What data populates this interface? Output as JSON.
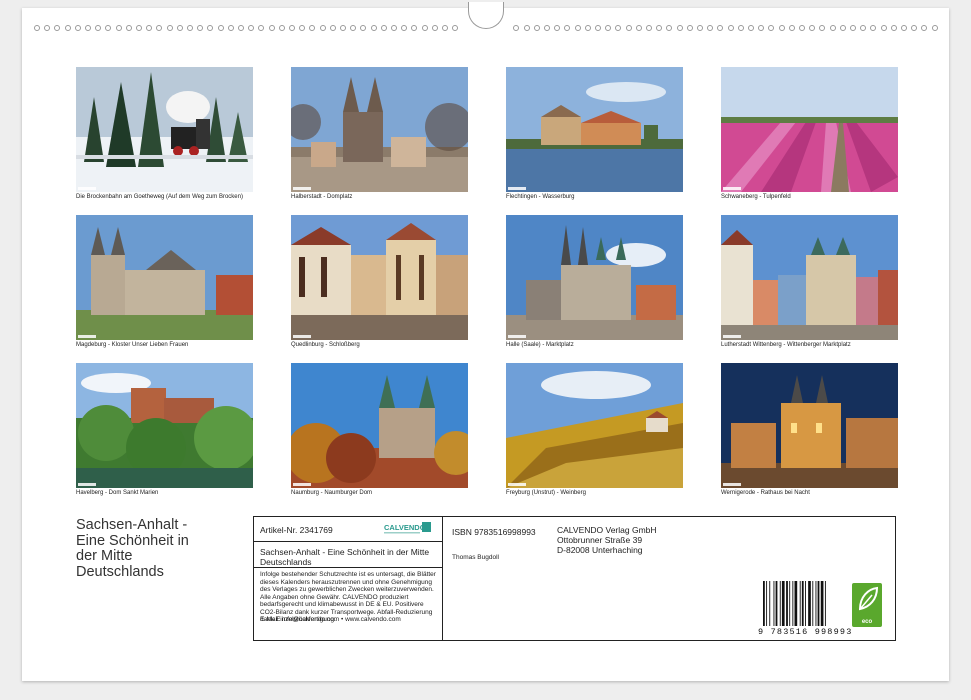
{
  "calendar": {
    "title_lines": [
      "Sachsen-Anhalt -",
      "Eine Schönheit in",
      "der Mitte",
      "Deutschlands"
    ]
  },
  "photos": [
    {
      "caption": "Die Brockenbahn am Goetheweg (Auf dem Weg zum Brocken)",
      "scene": "winter-train"
    },
    {
      "caption": "Halberstadt - Domplatz",
      "scene": "cathedral-twin-spires"
    },
    {
      "caption": "Flechtingen - Wasserburg",
      "scene": "water-castle"
    },
    {
      "caption": "Schwaneberg - Tulpenfeld",
      "scene": "tulip-field"
    },
    {
      "caption": "Magdeburg - Kloster Unser Lieben Frauen",
      "scene": "monastery"
    },
    {
      "caption": "Quedlinburg - Schloßberg",
      "scene": "half-timbered-houses"
    },
    {
      "caption": "Halle (Saale) - Marktplatz",
      "scene": "market-square"
    },
    {
      "caption": "Lutherstadt Wittenberg - Wittenberger Marktplatz",
      "scene": "wittenberg-square"
    },
    {
      "caption": "Havelberg - Dom Sankt Marien",
      "scene": "cathedral-green"
    },
    {
      "caption": "Naumburg - Naumburger Dom",
      "scene": "naumburg-cathedral"
    },
    {
      "caption": "Freyburg (Unstrut) - Weinberg",
      "scene": "vineyard"
    },
    {
      "caption": "Wernigerode - Rathaus bei Nacht",
      "scene": "town-hall-night"
    }
  ],
  "infobox": {
    "article_no": "Artikel-Nr. 2341769",
    "brand": "CALVENDO",
    "title": "Sachsen-Anhalt - Eine Schönheit in der Mitte Deutschlands",
    "legal": "Infolge bestehender Schutzrechte ist es untersagt, die Blätter dieses Kalenders herauszutrennen und ohne Genehmigung des Verlages zu gewerblichen Zwecken weiterzuverwenden. Alle Angaben ohne Gewähr. CALVENDO produziert bedarfsgerecht und klimabewusst in DE & EU. Positivere CO2-Bilanz dank kurzer Transportwege. Abfall-Reduzierung dank Einzelstückfertigung.",
    "email": "E-Mail: info@calvendo.com • www.calvendo.com",
    "isbn": "ISBN 9783516998993",
    "author": "Thomas Bugdoll",
    "publisher_name": "CALVENDO Verlag GmbH",
    "publisher_street": "Ottobrunner Straße 39",
    "publisher_city": "D-82008 Unterhaching",
    "barcode_digits": "9 783516 998993",
    "eco_label": "eco"
  },
  "colors": {
    "eco_green": "#5aa82d",
    "calvendo_teal": "#2a9a8e"
  }
}
